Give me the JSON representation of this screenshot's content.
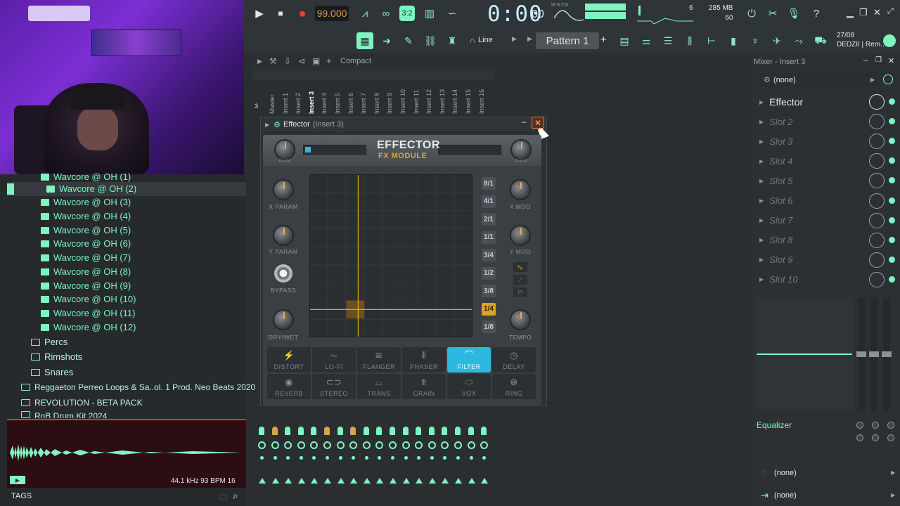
{
  "transport": {
    "tempo": "99.000",
    "time": "0:00",
    "time_small": "00",
    "time_unit": "M:S:CS",
    "cpu_num": "6",
    "memory": "285 MB",
    "memory2": "60"
  },
  "toolbar": {
    "snap_label": "Line",
    "pattern_label": "Pattern 1",
    "date": "27/08",
    "user": "DEDZII | Rem..."
  },
  "browser": {
    "samples": [
      "Wavcore @ OH (1)",
      "Wavcore @ OH (2)",
      "Wavcore @ OH (3)",
      "Wavcore @ OH (4)",
      "Wavcore @ OH (5)",
      "Wavcore @ OH (6)",
      "Wavcore @ OH (7)",
      "Wavcore @ OH (8)",
      "Wavcore @ OH (9)",
      "Wavcore @ OH (10)",
      "Wavcore @ OH (11)",
      "Wavcore @ OH (12)"
    ],
    "folders": [
      "Percs",
      "Rimshots",
      "Snares"
    ],
    "packs": [
      "Reggaeton Perreo Loops & Sa..ol. 1 Prod. Neo Beats 2020",
      "REVOLUTION - BETA PACK",
      "RnB Drum Kit 2024"
    ],
    "preview_info": "44.1 kHz 93 BPM 16",
    "tags_label": "TAGS"
  },
  "mixer": {
    "compact_label": "Compact",
    "channels": [
      "Master",
      "Insert 1",
      "Insert 2",
      "Insert 3",
      "Insert 4",
      "Insert 5",
      "Insert 6",
      "Insert 7",
      "Insert 8",
      "Insert 9",
      "Insert 10",
      "Insert 11",
      "Insert 12",
      "Insert 13",
      "Insert 14",
      "Insert 15",
      "Insert 16"
    ],
    "current_row": "3"
  },
  "effector": {
    "window_title": "Effector",
    "window_subtitle": "(Insert 3)",
    "logo_line1": "EFFECTOR",
    "logo_line2": "FX MODULE",
    "knob_labels": {
      "gain_left": "GAIN",
      "gain_right": "GAIN",
      "x_param": "X PARAM",
      "y_param": "Y PARAM",
      "bypass": "BYPASS",
      "dry_wet": "DRY/WET",
      "x_mod": "X MOD",
      "y_mod": "Y MOD",
      "tempo": "TEMPO"
    },
    "rates": [
      "8/1",
      "4/1",
      "2/1",
      "1/1",
      "3/4",
      "1/2",
      "3/8",
      "1/4",
      "1/8"
    ],
    "active_rate": "1/4",
    "effects_row1": [
      "DISTORT",
      "LO-FI",
      "FLANGER",
      "PHASER",
      "FILTER",
      "DELAY"
    ],
    "effects_row2": [
      "REVERB",
      "STEREO",
      "TRANS",
      "GRAIN",
      "VOX",
      "RING"
    ],
    "active_effect": "FILTER",
    "colors": {
      "accent": "#e0a31e",
      "active_fx": "#2db8e0"
    }
  },
  "mixer_panel": {
    "title": "Mixer - Insert 3",
    "input": "(none)",
    "slots": [
      "Effector",
      "Slot 2",
      "Slot 3",
      "Slot 4",
      "Slot 5",
      "Slot 6",
      "Slot 7",
      "Slot 8",
      "Slot 9",
      "Slot 10"
    ],
    "eq_label": "Equalizer",
    "output1": "(none)",
    "output2": "(none)"
  }
}
